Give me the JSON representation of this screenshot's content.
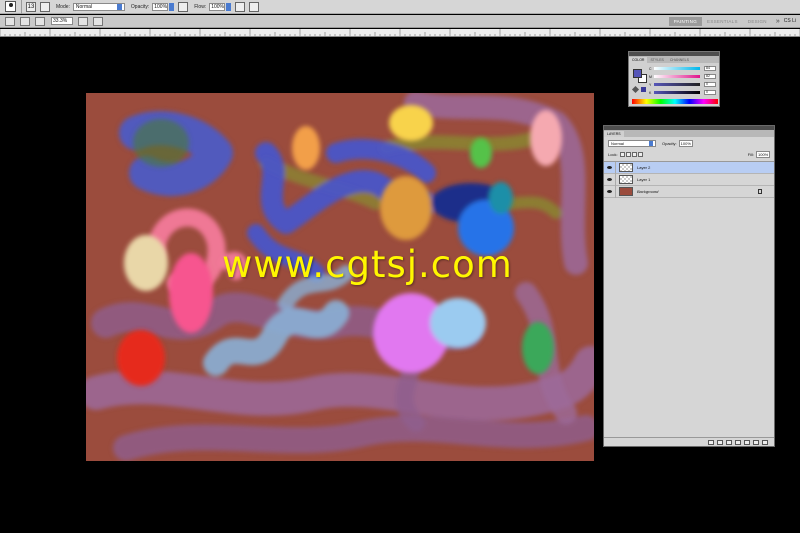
{
  "options_bar": {
    "mode_label": "Mode:",
    "mode_value": "Normal",
    "opacity_label": "Opacity:",
    "opacity_value": "100%",
    "flow_label": "Flow:",
    "flow_value": "100%",
    "brush_size": "13"
  },
  "app_bar": {
    "zoom": "33.3%",
    "workspaces": [
      {
        "label": "PAINTING",
        "active": true
      },
      {
        "label": "ESSENTIALS",
        "active": false
      },
      {
        "label": "DESIGN",
        "active": false
      }
    ],
    "more": "»",
    "cs_live": "CS Li"
  },
  "watermark": "www.cgtsj.com",
  "color_panel": {
    "tabs": [
      "COLOR",
      "STYLES",
      "CHANNELS"
    ],
    "sliders": [
      {
        "label": "C",
        "value": "84"
      },
      {
        "label": "M",
        "value": "82"
      },
      {
        "label": "Y",
        "value": "0"
      },
      {
        "label": "K",
        "value": "0"
      }
    ],
    "foreground": "#5656b9",
    "background": "#ffffff"
  },
  "layers_panel": {
    "title": "LAYERS",
    "blend_mode": "Normal",
    "opacity_label": "Opacity:",
    "opacity_value": "100%",
    "lock_label": "Lock:",
    "fill_label": "Fill:",
    "fill_value": "100%",
    "layers": [
      {
        "name": "Layer 2",
        "selected": true
      },
      {
        "name": "Layer 1",
        "selected": false
      },
      {
        "name": "Background",
        "selected": false
      }
    ]
  },
  "colors": {
    "canvas_bg": "#9b4c3d",
    "watermark": "#fff700",
    "selection": "#b8cdf3"
  }
}
